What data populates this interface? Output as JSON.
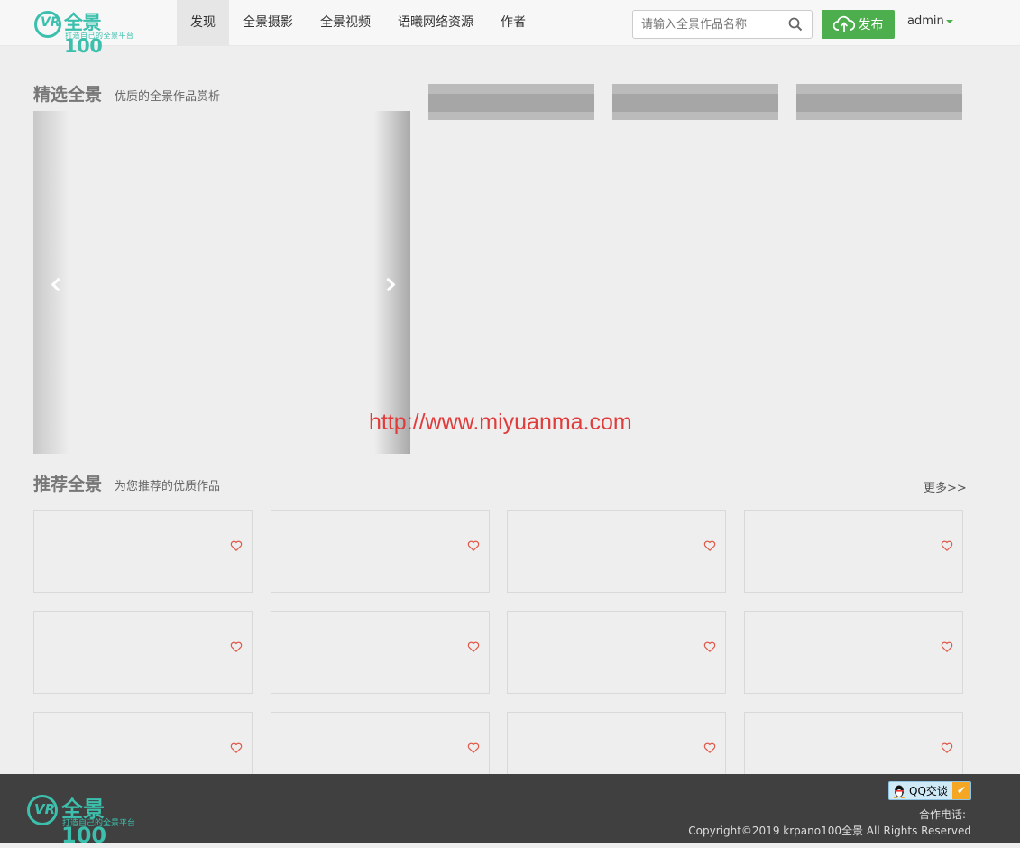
{
  "header": {
    "logo_name": "全景100",
    "logo_slogan": "打造自己的全景平台",
    "logo_mark": "VR",
    "nav": [
      {
        "label": "发现",
        "active": true
      },
      {
        "label": "全景摄影",
        "active": false
      },
      {
        "label": "全景视频",
        "active": false
      },
      {
        "label": "语曦网络资源",
        "active": false
      },
      {
        "label": "作者",
        "active": false
      }
    ],
    "search_placeholder": "请输入全景作品名称",
    "publish_label": "发布",
    "user": "admin"
  },
  "featured": {
    "title": "精选全景",
    "subtitle": "优质的全景作品赏析"
  },
  "recommended": {
    "title": "推荐全景",
    "subtitle": "为您推荐的优质作品",
    "more_label": "更多>>",
    "card_count": 12
  },
  "watermark": "http://www.miyuanma.com",
  "footer": {
    "logo_name": "全景100",
    "logo_slogan": "打造自己的全景平台",
    "logo_mark": "VR",
    "qq_label": "QQ交谈",
    "contact_label": "合作电话:",
    "copyright": "Copyright©2019 krpano100全景 All Rights Reserved"
  },
  "colors": {
    "brand": "#3cc0ad",
    "publish": "#4cae4c",
    "heart": "#e05a4a",
    "footer_bg": "#404040"
  }
}
